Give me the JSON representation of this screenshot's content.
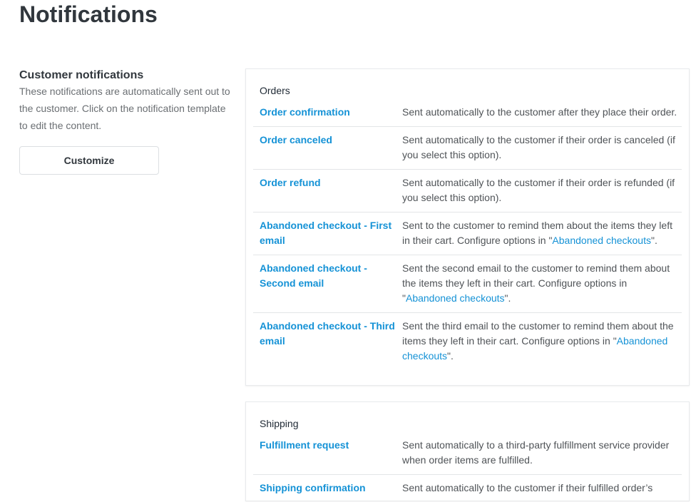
{
  "page": {
    "title": "Notifications"
  },
  "customer_notifications": {
    "title": "Customer notifications",
    "description": "These notifications are automatically sent out to the customer. Click on the notification template to edit the content.",
    "customize_label": "Customize"
  },
  "colors": {
    "link": "#1592d6",
    "heading": "#31373d"
  },
  "orders": {
    "heading": "Orders",
    "items": [
      {
        "name": "Order confirmation",
        "desc_pre": "Sent automatically to the customer after they place their order.",
        "link": "",
        "desc_post": ""
      },
      {
        "name": "Order canceled",
        "desc_pre": "Sent automatically to the customer if their order is canceled (if you select this option).",
        "link": "",
        "desc_post": ""
      },
      {
        "name": "Order refund",
        "desc_pre": "Sent automatically to the customer if their order is refunded (if you select this option).",
        "link": "",
        "desc_post": ""
      },
      {
        "name": "Abandoned checkout - First email",
        "desc_pre": "Sent to the customer to remind them about the items they left in their cart. Configure options in \"",
        "link": "Abandoned checkouts",
        "desc_post": "\"."
      },
      {
        "name": "Abandoned checkout - Second email",
        "desc_pre": "Sent the second email to the customer to remind them about the items they left in their cart. Configure options in \"",
        "link": "Abandoned checkouts",
        "desc_post": "\"."
      },
      {
        "name": "Abandoned checkout - Third email",
        "desc_pre": "Sent the third email to the customer to remind them about the items they left in their cart. Configure options in \"",
        "link": "Abandoned checkouts",
        "desc_post": "\"."
      }
    ]
  },
  "shipping": {
    "heading": "Shipping",
    "items": [
      {
        "name": "Fulfillment request",
        "desc_pre": "Sent automatically to a third-party fulfillment service provider when order items are fulfilled.",
        "link": "",
        "desc_post": ""
      },
      {
        "name": "Shipping confirmation",
        "desc_pre": "Sent automatically to the customer if their fulfilled order’s",
        "link": "",
        "desc_post": ""
      }
    ]
  }
}
